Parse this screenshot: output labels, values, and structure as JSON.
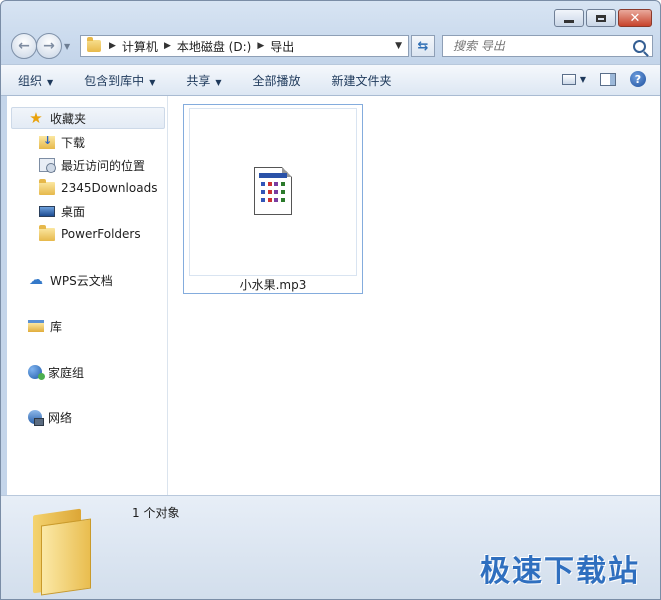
{
  "window": {
    "caption_buttons": [
      "minimize",
      "maximize",
      "close"
    ]
  },
  "address": {
    "crumbs": [
      "计算机",
      "本地磁盘 (D:)",
      "导出"
    ],
    "search_placeholder": "搜索 导出"
  },
  "toolbar": {
    "organize": "组织",
    "include_in_library": "包含到库中",
    "share": "共享",
    "play_all": "全部播放",
    "new_folder": "新建文件夹"
  },
  "sidebar": {
    "favorites": "收藏夹",
    "downloads": "下载",
    "recent_places": "最近访问的位置",
    "downloads_2345": "2345Downloads",
    "desktop": "桌面",
    "powerfolders": "PowerFolders",
    "wps_cloud": "WPS云文档",
    "libraries": "库",
    "homegroup": "家庭组",
    "network": "网络"
  },
  "files": [
    {
      "name": "小水果.mp3",
      "icon": "generic-document-icon",
      "selected": true
    }
  ],
  "details": {
    "count_text": "1 个对象"
  },
  "watermark": "极速下载站",
  "colors": {
    "accent": "#2f6fbf",
    "close_button": "#c7432b",
    "selection_border": "#84acdd"
  }
}
